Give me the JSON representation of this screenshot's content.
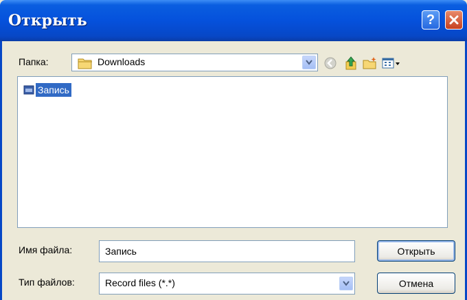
{
  "window": {
    "title": "Открыть",
    "help_label": "?"
  },
  "folder": {
    "label": "Папка:",
    "value": "Downloads"
  },
  "files": [
    {
      "name": "Запись",
      "selected": true
    }
  ],
  "filename": {
    "label": "Имя файла:",
    "value": "Запись"
  },
  "filetype": {
    "label": "Тип файлов:",
    "value": "Record files (*.*)"
  },
  "buttons": {
    "open": "Открыть",
    "cancel": "Отмена"
  },
  "icons": {
    "folder": "folder-icon",
    "back": "back-icon",
    "up": "up-folder-icon",
    "new_folder": "new-folder-icon",
    "views": "views-menu-icon",
    "file": "record-file-icon"
  },
  "colors": {
    "titlebar": "#0551dc",
    "selection": "#316ac5",
    "dialog_bg": "#ece9d8"
  }
}
